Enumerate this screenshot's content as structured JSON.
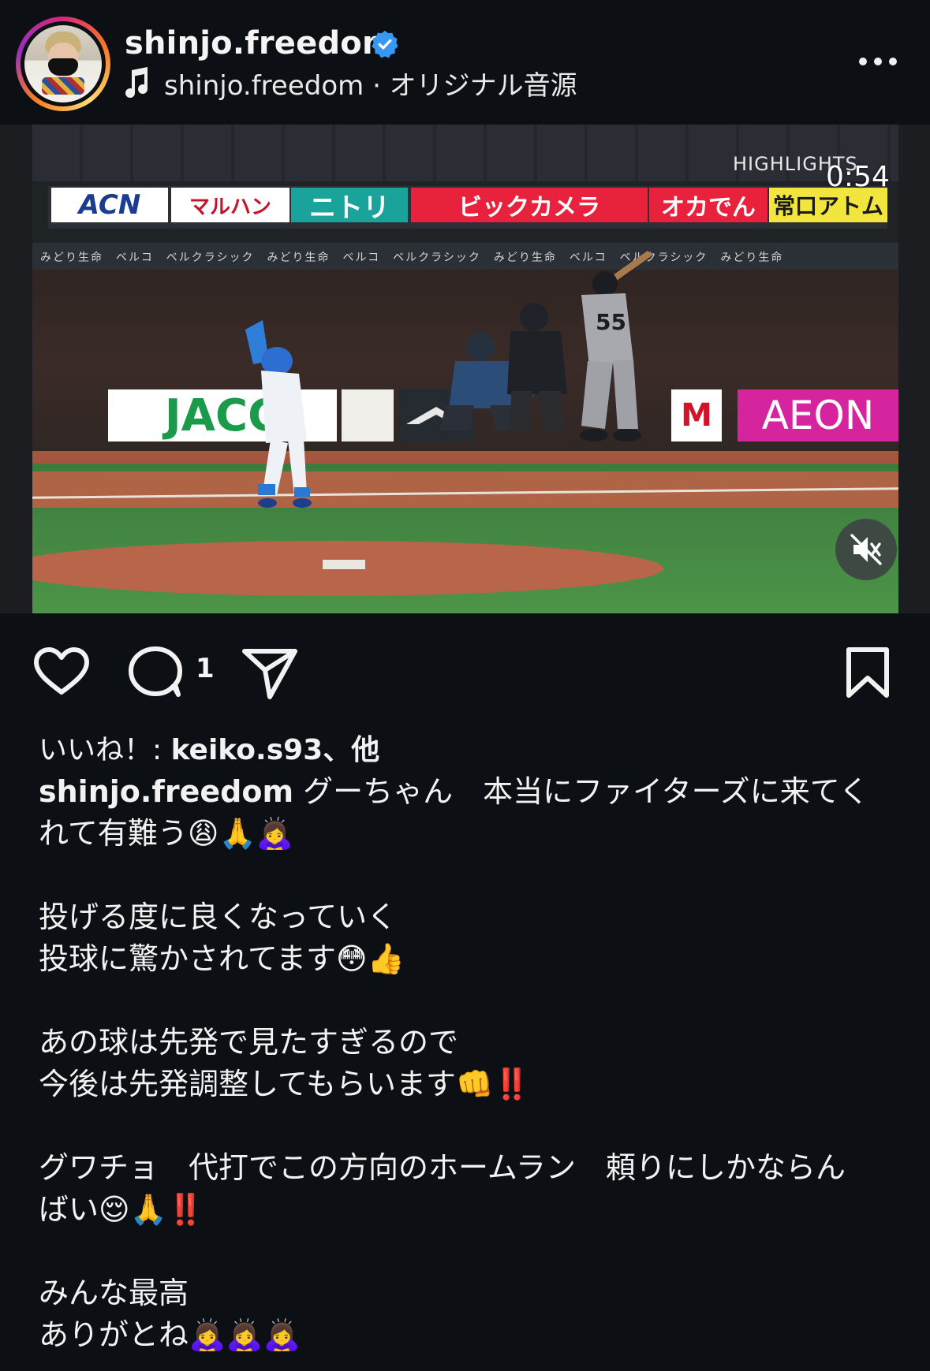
{
  "header": {
    "username": "shinjo.freedom",
    "audio_label": "shinjo.freedom · オリジナル音源"
  },
  "video": {
    "overlay_label": "HIGHLIGHTS",
    "timer": "0:54",
    "ads_top": [
      "ACN",
      "マルハン",
      "ニトリ",
      "ビックカメラ",
      "オカでん",
      "常口アトム"
    ],
    "ribbon": "みどり生命　ベルコ　ベルクラシック　みどり生命　ベルコ　ベルクラシック　みどり生命　ベルコ　ベルクラシック　みどり生命",
    "ads_wall": [
      "JACC",
      "AEON"
    ],
    "player_number": "55"
  },
  "actions": {
    "comment_count": "1"
  },
  "caption": {
    "likes_prefix": "いいね！: ",
    "likes_user": "keiko.s93、他",
    "author": "shinjo.freedom",
    "line1": " グーちゃん　本当にファイターズに来てく",
    "line2": "れて有難う😩🙏🙇‍♀️",
    "line3": "投げる度に良くなっていく",
    "line4": "投球に驚かされてます😳👍",
    "line5": "あの球は先発で見たすぎるので",
    "line6": "今後は先発調整してもらいます👊‼️",
    "line7": "グワチョ　代打でこの方向のホームラン　頼りにしかならん",
    "line8": "ばい😌🙏‼️",
    "line9": "みんな最高",
    "line10": "ありがとね🙇‍♀️🙇‍♀️🙇‍♀️"
  },
  "colors": {
    "background": "#0c0f14",
    "verified": "#3897f0",
    "text": "#f2f2f2"
  }
}
